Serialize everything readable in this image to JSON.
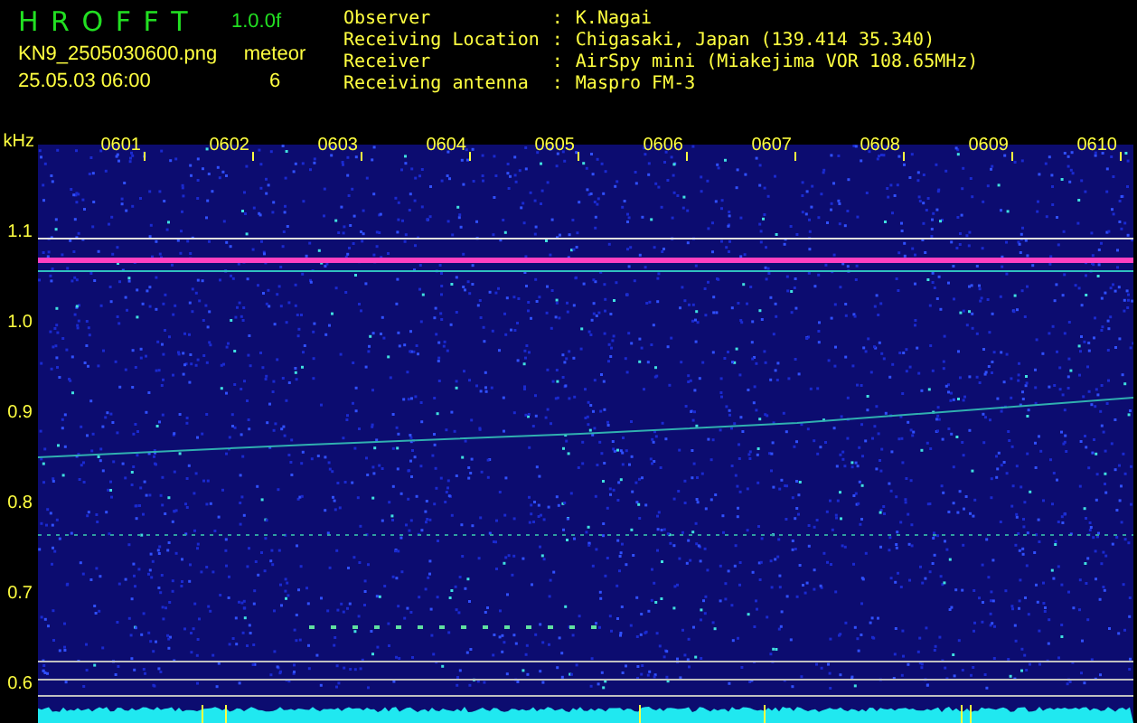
{
  "header": {
    "title": "H R O F F T",
    "version": "1.0.0f",
    "filename": "KN9_2505030600.png",
    "timestamp": "25.05.03 06:00",
    "mode_label": "meteor",
    "count": "6"
  },
  "info": [
    {
      "label": "Observer",
      "separator": ":",
      "value": "K.Nagai"
    },
    {
      "label": "Receiving Location",
      "separator": ":",
      "value": "Chigasaki, Japan (139.414 35.340)"
    },
    {
      "label": "Receiver",
      "separator": ":",
      "value": "AirSpy mini (Miakejima VOR 108.65MHz)"
    },
    {
      "label": "Receiving antenna",
      "separator": ":",
      "value": "Maspro FM-3"
    }
  ],
  "plot": {
    "unit": "kHz",
    "y_labels": [
      "1.1",
      "1.0",
      "0.9",
      "0.8",
      "0.7",
      "0.6"
    ],
    "time_labels": [
      "0601",
      "0602",
      "0603",
      "0604",
      "0605",
      "0606",
      "0607",
      "0608",
      "0609",
      "0610"
    ]
  }
}
